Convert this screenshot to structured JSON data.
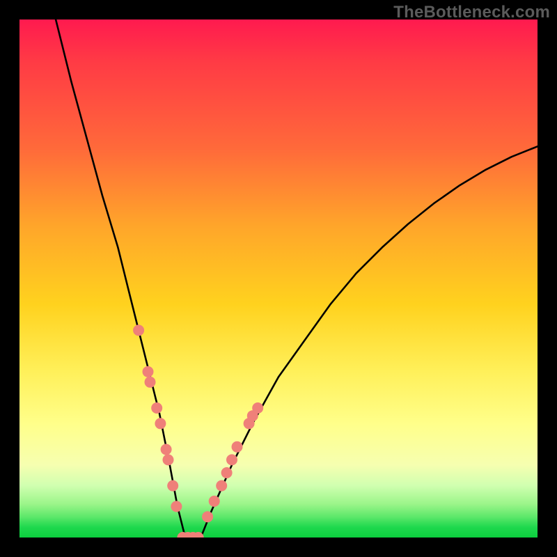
{
  "watermark": "TheBottleneck.com",
  "chart_data": {
    "type": "line",
    "title": "",
    "xlabel": "",
    "ylabel": "",
    "xlim": [
      0,
      100
    ],
    "ylim": [
      0,
      100
    ],
    "grid": false,
    "legend": false,
    "background_gradient": {
      "direction": "vertical",
      "stops": [
        {
          "pos": 0.0,
          "color": "#ff1a4f"
        },
        {
          "pos": 0.25,
          "color": "#ff6a3a"
        },
        {
          "pos": 0.55,
          "color": "#ffd21e"
        },
        {
          "pos": 0.78,
          "color": "#ffff8a"
        },
        {
          "pos": 0.93,
          "color": "#9cf58a"
        },
        {
          "pos": 1.0,
          "color": "#0ccf3e"
        }
      ]
    },
    "series": [
      {
        "name": "bottleneck-curve",
        "x": [
          7,
          10,
          13,
          16,
          19,
          21,
          23,
          25,
          27,
          29,
          30.5,
          32,
          33.5,
          35,
          37,
          41,
          45,
          50,
          55,
          60,
          65,
          70,
          75,
          80,
          85,
          90,
          95,
          100
        ],
        "y": [
          100,
          88,
          77,
          66,
          56,
          48,
          40,
          32,
          24,
          14,
          6,
          0,
          0,
          0,
          5,
          14,
          22,
          31,
          38,
          45,
          51,
          56,
          60.5,
          64.5,
          68,
          71,
          73.5,
          75.5
        ]
      }
    ],
    "markers": {
      "name": "highlight-dots",
      "color": "#ef8079",
      "radius": 8,
      "points": [
        {
          "x": 23.0,
          "y": 40.0
        },
        {
          "x": 24.8,
          "y": 32.0
        },
        {
          "x": 25.2,
          "y": 30.0
        },
        {
          "x": 26.5,
          "y": 25.0
        },
        {
          "x": 27.2,
          "y": 22.0
        },
        {
          "x": 28.3,
          "y": 17.0
        },
        {
          "x": 28.7,
          "y": 15.0
        },
        {
          "x": 29.6,
          "y": 10.0
        },
        {
          "x": 30.3,
          "y": 6.0
        },
        {
          "x": 31.5,
          "y": 0.0
        },
        {
          "x": 32.5,
          "y": 0.0
        },
        {
          "x": 33.5,
          "y": 0.0
        },
        {
          "x": 34.5,
          "y": 0.0
        },
        {
          "x": 36.3,
          "y": 4.0
        },
        {
          "x": 37.6,
          "y": 7.0
        },
        {
          "x": 39.0,
          "y": 10.0
        },
        {
          "x": 40.0,
          "y": 12.5
        },
        {
          "x": 41.0,
          "y": 15.0
        },
        {
          "x": 42.0,
          "y": 17.5
        },
        {
          "x": 44.3,
          "y": 22.0
        },
        {
          "x": 45.0,
          "y": 23.5
        },
        {
          "x": 46.0,
          "y": 25.0
        }
      ]
    }
  }
}
